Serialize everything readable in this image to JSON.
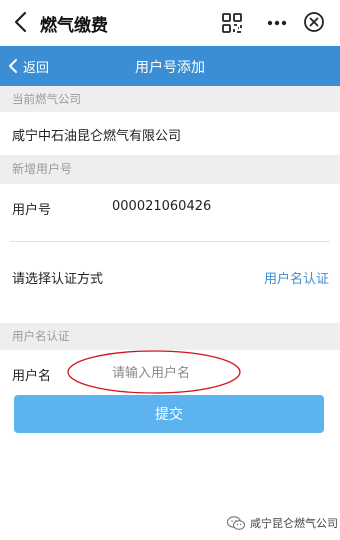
{
  "window": {
    "title": "燃气缴费"
  },
  "nav": {
    "back_label": "返回",
    "title": "用户号添加"
  },
  "company": {
    "header": "当前燃气公司",
    "name": "咸宁中石油昆仑燃气有限公司"
  },
  "account": {
    "header": "新增用户号",
    "label": "用户号",
    "value": "000021060426"
  },
  "auth": {
    "prompt": "请选择认证方式",
    "method": "用户名认证"
  },
  "username": {
    "header": "用户名认证",
    "label": "用户名",
    "placeholder": "请输入用户名",
    "value": ""
  },
  "submit": {
    "label": "提交"
  },
  "watermark": {
    "text": "咸宁昆仑燃气公司"
  },
  "colors": {
    "accent": "#3b8ed3",
    "button": "#5db3f0",
    "annotation": "#d0121b"
  }
}
